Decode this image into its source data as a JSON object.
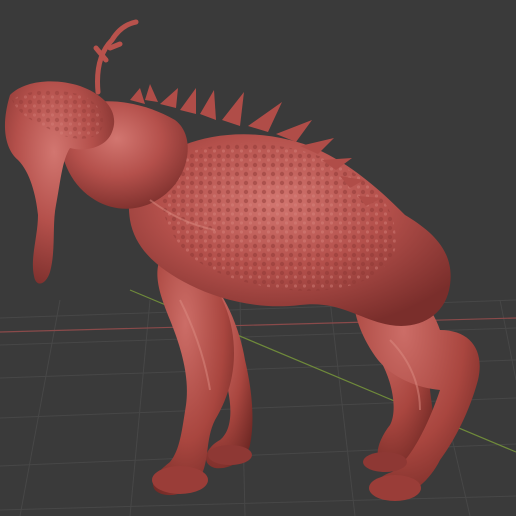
{
  "viewport": {
    "background_color": "#3a3a3a",
    "grid_color": "#474747",
    "x_axis_color": "#8a4a4a",
    "y_axis_color": "#6f8a3a",
    "grid_visible": true
  },
  "model": {
    "name": "sculpted-creature",
    "material_color": "#b9534f",
    "shadow_color": "#7d2f2d",
    "highlight_color": "#d77a72"
  }
}
